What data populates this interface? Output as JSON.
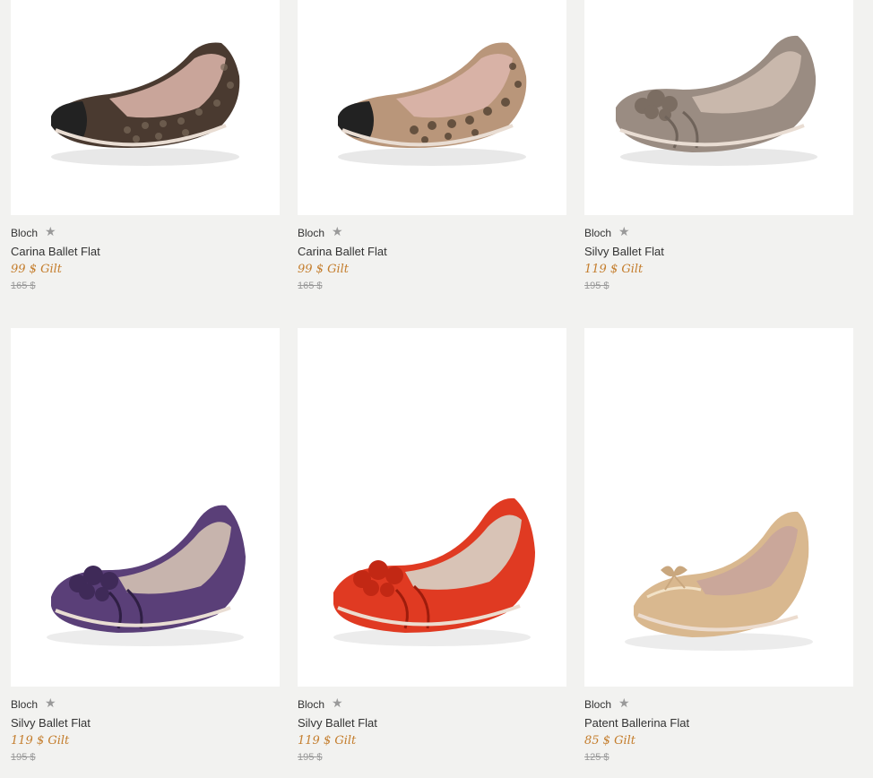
{
  "products": [
    {
      "brand": "Bloch",
      "name": "Carina Ballet Flat",
      "sale_price": "99 $ Gilt",
      "original_price": "165 $",
      "star_icon": "★"
    },
    {
      "brand": "Bloch",
      "name": "Carina Ballet Flat",
      "sale_price": "99 $ Gilt",
      "original_price": "165 $",
      "star_icon": "★"
    },
    {
      "brand": "Bloch",
      "name": "Silvy Ballet Flat",
      "sale_price": "119 $ Gilt",
      "original_price": "195 $",
      "star_icon": "★"
    },
    {
      "brand": "Bloch",
      "name": "Silvy Ballet Flat",
      "sale_price": "119 $ Gilt",
      "original_price": "195 $",
      "star_icon": "★"
    },
    {
      "brand": "Bloch",
      "name": "Silvy Ballet Flat",
      "sale_price": "119 $ Gilt",
      "original_price": "195 $",
      "star_icon": "★"
    },
    {
      "brand": "Bloch",
      "name": "Patent Ballerina Flat",
      "sale_price": "85 $ Gilt",
      "original_price": "125 $",
      "star_icon": "★"
    }
  ],
  "colors": {
    "page_bg": "#f2f2f0",
    "sale_price": "#c47d2c",
    "original_price": "#999999"
  }
}
